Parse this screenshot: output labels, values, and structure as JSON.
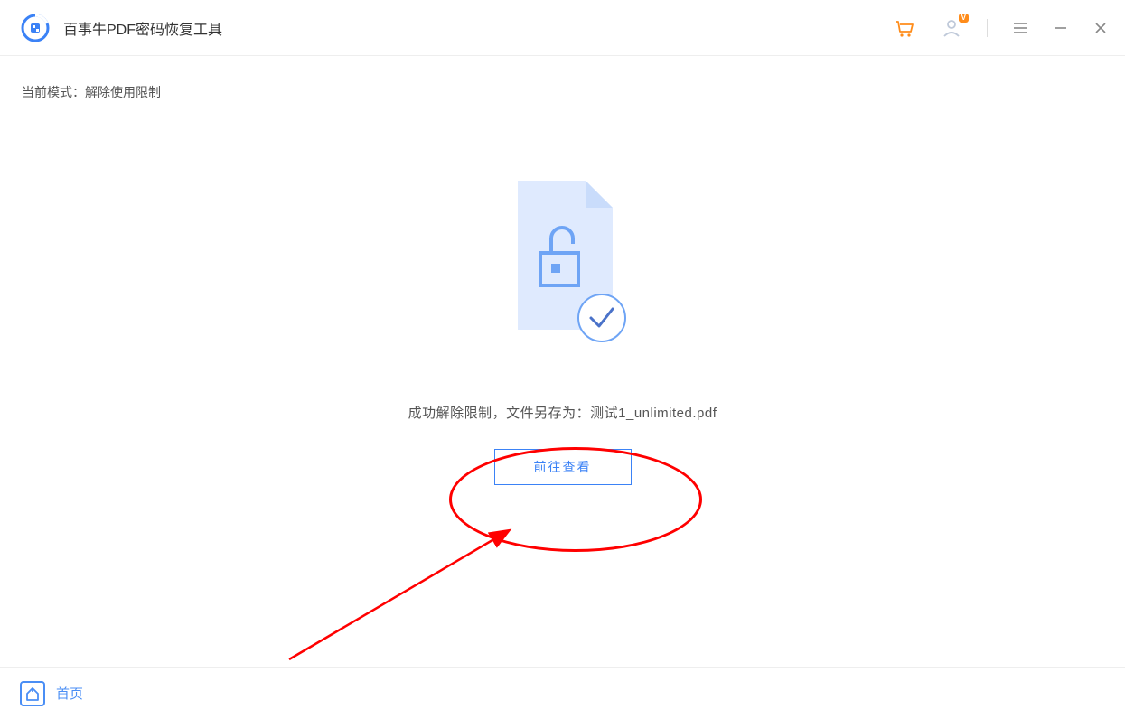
{
  "header": {
    "app_title": "百事牛PDF密码恢复工具"
  },
  "sub_header": {
    "mode_label": "当前模式：",
    "mode_value": "解除使用限制"
  },
  "main": {
    "success_message": "成功解除限制，文件另存为：",
    "saved_filename": "测试1_unlimited.pdf",
    "view_button_label": "前往查看"
  },
  "footer": {
    "home_label": "首页"
  },
  "colors": {
    "primary": "#4a8ef5",
    "annotation": "#ff0000",
    "orange_badge": "#ff8c1a"
  }
}
